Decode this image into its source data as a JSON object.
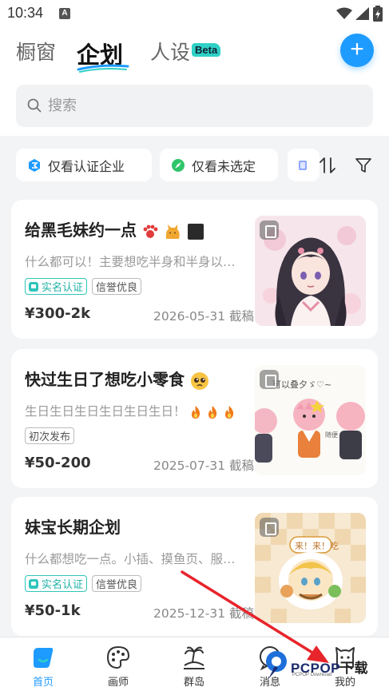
{
  "status_bar": {
    "time": "10:34",
    "notification_badge": "A"
  },
  "header": {
    "tabs": [
      {
        "label": "橱窗",
        "active": false
      },
      {
        "label": "企划",
        "active": true
      },
      {
        "label": "人设",
        "active": false
      }
    ],
    "beta_badge": "Beta",
    "add_button": "+"
  },
  "search": {
    "placeholder": "搜索"
  },
  "filters": {
    "chips": [
      {
        "label": "仅看认证企业",
        "icon": "enterprise-icon"
      },
      {
        "label": "仅看未选定",
        "icon": "compass-icon"
      }
    ],
    "sort_icon": "sort-icon",
    "filter_icon": "funnel-icon"
  },
  "cards": [
    {
      "title": "给黑毛妹约一点",
      "title_emojis": [
        "paw-emoji",
        "cat-emoji",
        "black-square-emoji"
      ],
      "description": "什么都可以！主要想吃半身和半身以…",
      "tags": [
        {
          "label": "实名认证",
          "type": "verify"
        },
        {
          "label": "信誉优良",
          "type": "plain"
        }
      ],
      "price": "¥300-2k",
      "deadline": "2026-05-31 截稿",
      "thumbnail": "anime-girl-illustration"
    },
    {
      "title": "快过生日了想吃小零食",
      "title_emojis": [
        "pleading-face-emoji"
      ],
      "description": "生日生日生日生日生日生日！",
      "description_emojis": [
        "fire-emoji",
        "fire-emoji",
        "fire-emoji"
      ],
      "tags": [
        {
          "label": "初次发布",
          "type": "plain"
        }
      ],
      "price": "¥50-200",
      "deadline": "2025-07-31 截稿",
      "thumbnail": "chibi-characters-sketch",
      "thumbnail_text": "可以叠夕ゞ♡~"
    },
    {
      "title": "妹宝长期企划",
      "description": "什么都想吃一点。小插、摸鱼页、服…",
      "tags": [
        {
          "label": "实名认证",
          "type": "verify"
        },
        {
          "label": "信誉优良",
          "type": "plain"
        }
      ],
      "price": "¥50-1k",
      "deadline": "2025-12-31 截稿",
      "thumbnail": "chibi-sticker-illustration",
      "thumbnail_text": "来！来！吃"
    }
  ],
  "bottom_nav": [
    {
      "label": "首页",
      "icon": "home-icon",
      "active": true
    },
    {
      "label": "画师",
      "icon": "palette-icon",
      "active": false
    },
    {
      "label": "群岛",
      "icon": "island-icon",
      "active": false
    },
    {
      "label": "消息",
      "icon": "message-icon",
      "active": false
    },
    {
      "label": "我的",
      "icon": "profile-icon",
      "active": false
    }
  ],
  "watermark": {
    "brand": "PCPOP",
    "brand_cn": "下载",
    "sub": "PCPOP Download"
  },
  "colors": {
    "accent": "#1e9bff",
    "verify": "#2fc5bb",
    "annotation_arrow": "#e8242b"
  }
}
